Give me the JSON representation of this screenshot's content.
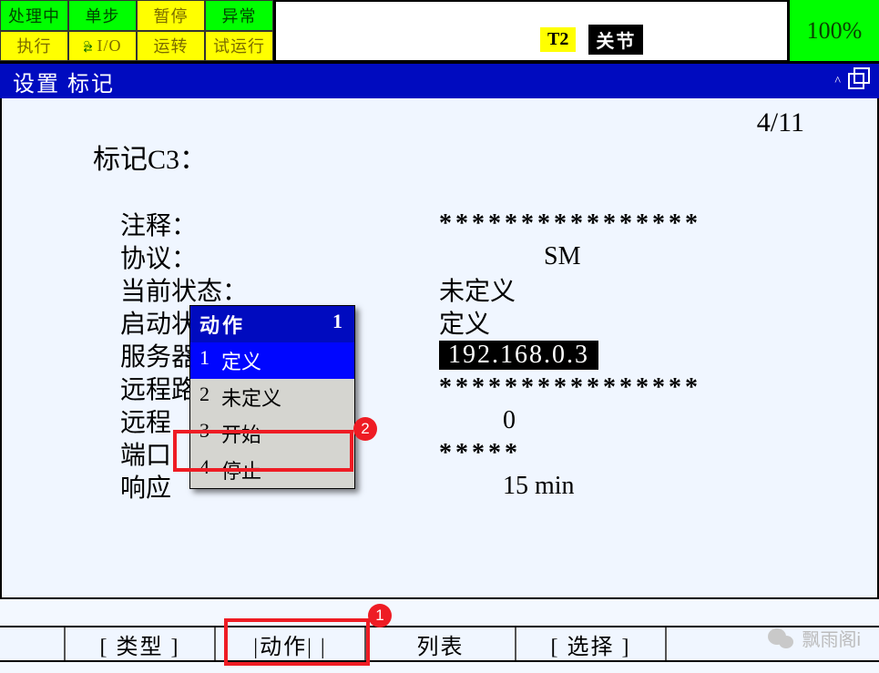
{
  "top": {
    "row1": [
      "处理中",
      "单步",
      "暂停",
      "异常"
    ],
    "row2": [
      "执行",
      "I/O",
      "运转",
      "试运行"
    ],
    "chip_t2": "T2",
    "chip_joint": "关节",
    "percent": "100%"
  },
  "title": "设置 标记",
  "page_counter": "4/11",
  "heading": "标记C3：",
  "fields": {
    "comment_label": "注释：",
    "comment_value": "****************",
    "protocol_label": "协议：",
    "protocol_value": "SM",
    "cur_state_label": "当前状态：",
    "cur_state_value": "未定义",
    "start_state_label": "启动状态：",
    "start_state_value": "定义",
    "server_label": "服务器IP/主机名称：",
    "server_value": "192.168.0.3",
    "remote_path_label": "远程路径/共享：",
    "remote_path_value": "****************",
    "remote_port_label": "远程",
    "remote_port_value": "0",
    "port_label": "端口",
    "port_value": "*****",
    "resp_label": "响应",
    "resp_value": "15 min"
  },
  "popup": {
    "header_text": "动作",
    "header_count": "1",
    "items": [
      {
        "idx": "1",
        "label": "定义",
        "selected": true
      },
      {
        "idx": "2",
        "label": "未定义",
        "selected": false
      },
      {
        "idx": "3",
        "label": "开始",
        "selected": false
      },
      {
        "idx": "4",
        "label": "停止",
        "selected": false
      }
    ]
  },
  "bottom": {
    "type": "[ 类型 ]",
    "action": "|动作| |",
    "list": "列表",
    "select": "[ 选择 ]"
  },
  "anno": {
    "b1": "1",
    "b2": "2"
  },
  "wechat": "飘雨阁i"
}
